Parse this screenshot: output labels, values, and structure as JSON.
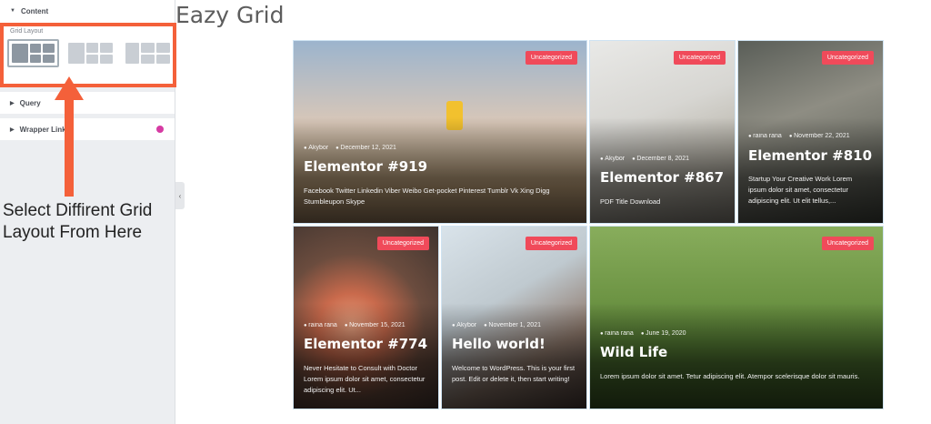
{
  "panel": {
    "content_label": "Content",
    "grid_layout_label": "Grid Layout",
    "query_label": "Query",
    "wrapper_link_label": "Wrapper Link"
  },
  "callout": {
    "text": "Select Diffirent Grid Layout From Here",
    "color": "#f4603a"
  },
  "page": {
    "title": "Eazy Grid"
  },
  "cards": [
    {
      "category": "Uncategorized",
      "author": "Akybor",
      "date": "December 12, 2021",
      "title": "Elementor #919",
      "excerpt": "Facebook Twitter Linkedin Viber Weibo Get-pocket Pinterest Tumblr Vk Xing Digg Stumbleupon Skype"
    },
    {
      "category": "Uncategorized",
      "author": "Akybor",
      "date": "December 8, 2021",
      "title": "Elementor #867",
      "excerpt": "PDF Title Download"
    },
    {
      "category": "Uncategorized",
      "author": "raina rana",
      "date": "November 22, 2021",
      "title": "Elementor #810",
      "excerpt": "Startup Your Creative Work Lorem ipsum dolor sit amet, consectetur adipiscing elit. Ut elit tellus,..."
    },
    {
      "category": "Uncategorized",
      "author": "raina rana",
      "date": "November 15, 2021",
      "title": "Elementor #774",
      "excerpt": "Never Hesitate to Consult with Doctor Lorem ipsum dolor sit amet, consectetur adipiscing elit. Ut..."
    },
    {
      "category": "Uncategorized",
      "author": "Akybor",
      "date": "November 1, 2021",
      "title": "Hello world!",
      "excerpt": "Welcome to WordPress. This is your first post. Edit or delete it, then start writing!"
    },
    {
      "category": "Uncategorized",
      "author": "raina rana",
      "date": "June 19, 2020",
      "title": "Wild Life",
      "excerpt": "Lorem ipsum dolor sit amet. Tetur adipiscing elit. Atempor scelerisque dolor sit mauris."
    }
  ],
  "colors": {
    "badge": "#f04a5a",
    "highlight": "#f4603a"
  }
}
